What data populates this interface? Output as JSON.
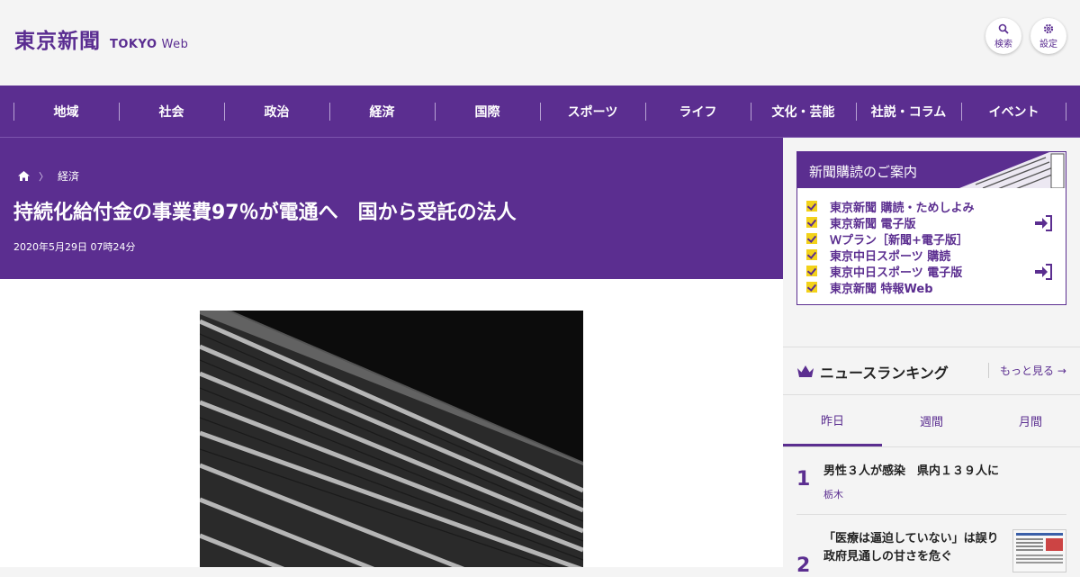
{
  "header": {
    "logo_ja": "東京新聞",
    "logo_en": "TOKYO",
    "logo_web": "Web",
    "search_label": "検索",
    "settings_label": "設定"
  },
  "nav": {
    "items": [
      "地域",
      "社会",
      "政治",
      "経済",
      "国際",
      "スポーツ",
      "ライフ",
      "文化・芸能",
      "社説・コラム",
      "イベント"
    ]
  },
  "article": {
    "breadcrumb_category": "経済",
    "title": "持続化給付金の事業費97％が電通へ　国から受託の法人",
    "date": "2020年5月29日 07時24分"
  },
  "subscription": {
    "heading": "新聞購読のご案内",
    "items": [
      "東京新聞 購読・ためしよみ",
      "東京新聞 電子版",
      "Ｗプラン［新聞+電子版］",
      "東京中日スポーツ 購読",
      "東京中日スポーツ 電子版",
      "東京新聞 特報Web"
    ]
  },
  "ranking": {
    "title": "ニュースランキング",
    "more": "もっと見る",
    "tabs": [
      "昨日",
      "週間",
      "月間"
    ],
    "items": [
      {
        "rank": "1",
        "text": "男性３人が感染　県内１３９人に",
        "tag": "栃木"
      },
      {
        "rank": "2",
        "text": "「医療は逼迫していない」は誤り　政府見通しの甘さを危ぐ",
        "tag": ""
      }
    ]
  },
  "colors": {
    "brand": "#5b2e90",
    "accent": "#f3d21a"
  }
}
